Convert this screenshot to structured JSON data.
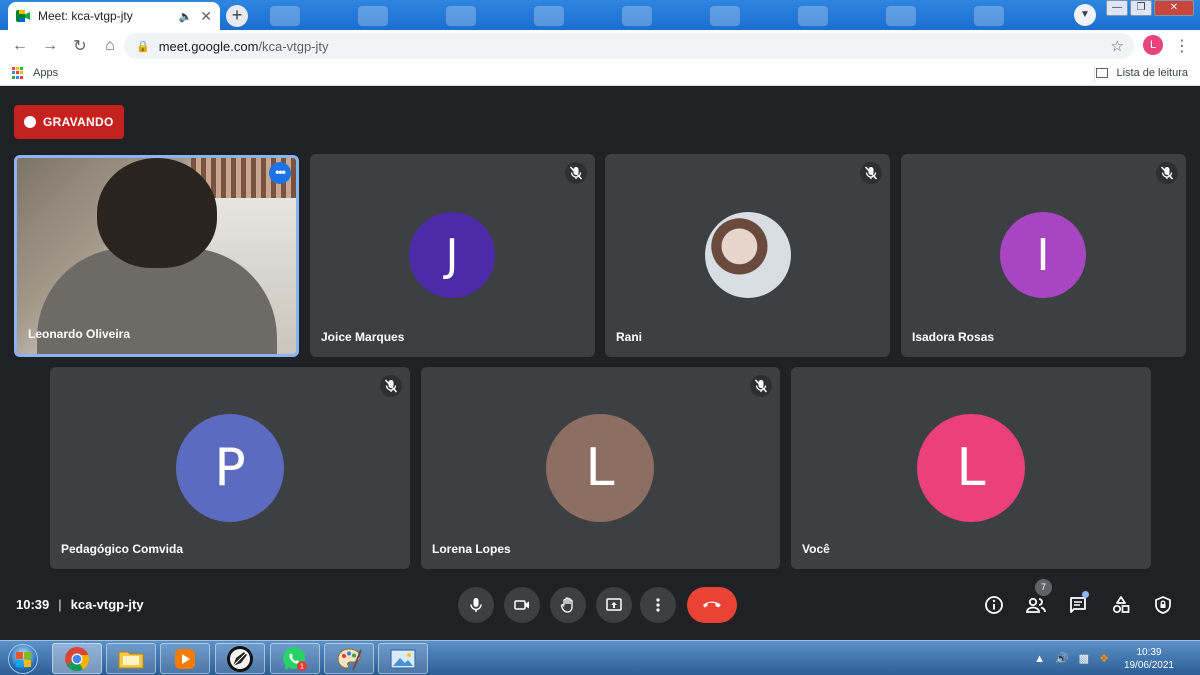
{
  "browser": {
    "tab_title": "Meet: kca-vtgp-jty",
    "new_tab_label": "+",
    "url_host": "meet.google.com",
    "url_path": "/kca-vtgp-jty",
    "profile_initial": "L",
    "bookmarks_apps_label": "Apps",
    "reading_list_label": "Lista de leitura"
  },
  "meet": {
    "recording_label": "GRAVANDO",
    "participants": [
      {
        "name": "Leonardo Oliveira",
        "kind": "video"
      },
      {
        "name": "Joice Marques",
        "initial": "J",
        "color": "#4c2ba8"
      },
      {
        "name": "Rani",
        "kind": "photo"
      },
      {
        "name": "Isadora Rosas",
        "initial": "I",
        "color": "#a845c0"
      },
      {
        "name": "Pedagógico Comvida",
        "initial": "P",
        "color": "#5c6bc0"
      },
      {
        "name": "Lorena Lopes",
        "initial": "L",
        "color": "#8d6e63"
      },
      {
        "name": "Você",
        "initial": "L",
        "color": "#ec407a"
      }
    ],
    "time": "10:39",
    "separator": "|",
    "meeting_code": "kca-vtgp-jty",
    "people_count": "7",
    "accent_colors": {
      "end_call": "#ea4335",
      "recording": "#c5221f",
      "active_border": "#8ab4f8"
    }
  },
  "taskbar": {
    "clock_time": "10:39",
    "clock_date": "19/06/2021",
    "whatsapp_badge": "1"
  }
}
